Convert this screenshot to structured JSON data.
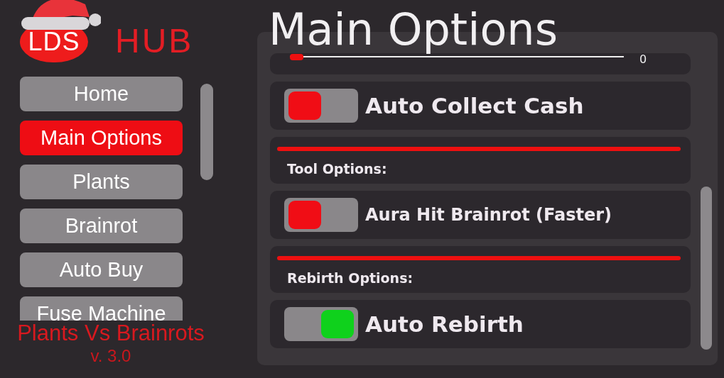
{
  "logo": {
    "badge": "LDS",
    "title": "HUB"
  },
  "nav": [
    {
      "label": "Home",
      "selected": false
    },
    {
      "label": "Main Options",
      "selected": true
    },
    {
      "label": "Plants",
      "selected": false
    },
    {
      "label": "Brainrot",
      "selected": false
    },
    {
      "label": "Auto Buy",
      "selected": false
    },
    {
      "label": "Fuse Machine",
      "selected": false
    }
  ],
  "footer": {
    "game": "Plants Vs Brainrots",
    "version": "v. 3.0"
  },
  "page": {
    "title": "Main Options"
  },
  "options": [
    {
      "kind": "slider",
      "level": 0.04,
      "reading": "0"
    },
    {
      "kind": "toggle",
      "label": "Auto Collect Cash",
      "on": false
    },
    {
      "kind": "section",
      "label": "Tool Options:"
    },
    {
      "kind": "toggle",
      "label": "Aura Hit Brainrot (Faster)",
      "on": false
    },
    {
      "kind": "section",
      "label": "Rebirth Options:"
    },
    {
      "kind": "toggle",
      "label": "Auto Rebirth",
      "on": true
    }
  ]
}
